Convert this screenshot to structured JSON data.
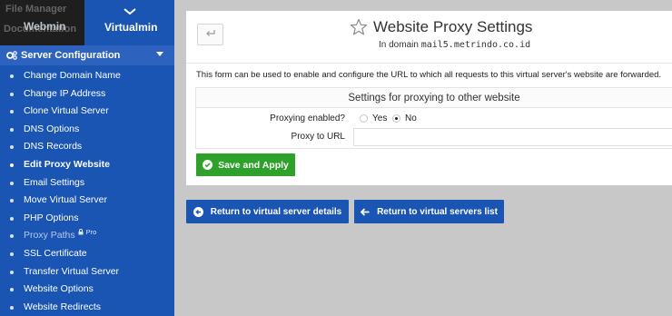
{
  "sidebar": {
    "ghost_top": "File Manager",
    "ghost_mid": "Documentation",
    "tab_webmin": "Webmin",
    "tab_virtualmin": "Virtualmin",
    "section_title": "Server Configuration",
    "items": [
      {
        "label": "Change Domain Name"
      },
      {
        "label": "Change IP Address"
      },
      {
        "label": "Clone Virtual Server"
      },
      {
        "label": "DNS Options"
      },
      {
        "label": "DNS Records"
      },
      {
        "label": "Edit Proxy Website"
      },
      {
        "label": "Email Settings"
      },
      {
        "label": "Move Virtual Server"
      },
      {
        "label": "PHP Options"
      },
      {
        "label": "Proxy Paths",
        "badge": "Pro"
      },
      {
        "label": "SSL Certificate"
      },
      {
        "label": "Transfer Virtual Server"
      },
      {
        "label": "Website Options"
      },
      {
        "label": "Website Redirects"
      }
    ]
  },
  "page": {
    "title": "Website Proxy Settings",
    "subtitle_prefix": "In domain",
    "domain": "mail5.metrindo.co.id",
    "description": "This form can be used to enable and configure the URL to which all requests to this virtual server's website are forwarded.",
    "settings_title": "Settings for proxying to other website",
    "proxy_enabled_label": "Proxying enabled?",
    "yes_label": "Yes",
    "no_label": "No",
    "proxy_enabled_value": "No",
    "proxy_url_label": "Proxy to URL",
    "proxy_url_value": "",
    "save_label": "Save and Apply"
  },
  "footer": {
    "return_details": "Return to virtual server details",
    "return_list": "Return to virtual servers list"
  },
  "colors": {
    "sidebar": "#1a55b4",
    "save": "#2ea12b",
    "return_buttons": "#1a55b4"
  }
}
